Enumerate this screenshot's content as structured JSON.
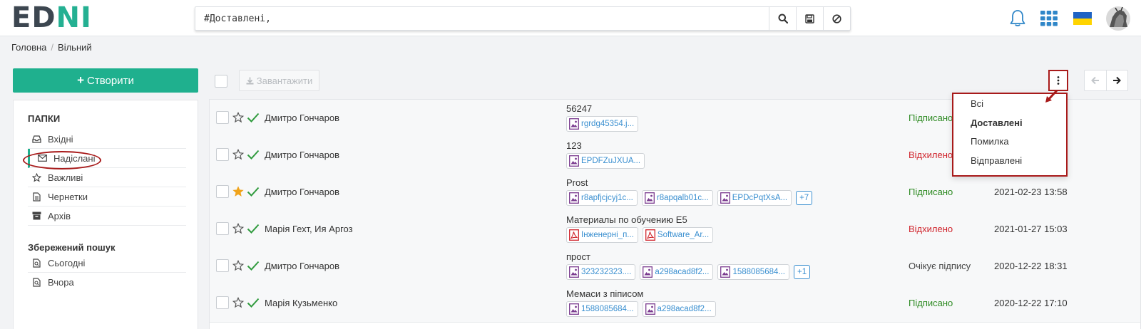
{
  "app": {
    "logo_left": "ED",
    "logo_right": "NI"
  },
  "search": {
    "value": "#Доставлені,",
    "buttons": [
      "search-icon",
      "save-icon",
      "clear-icon"
    ]
  },
  "header_icons": [
    "bell-icon",
    "apps-grid-icon",
    "ukraine-flag-icon",
    "user-avatar"
  ],
  "breadcrumb": {
    "home": "Головна",
    "current": "Вільний"
  },
  "sidebar": {
    "create_label": "Створити",
    "folders_title": "ПАПКИ",
    "folders": [
      {
        "label": "Вхідні",
        "icon": "inbox-icon"
      },
      {
        "label": "Надіслані",
        "icon": "envelope-icon",
        "active": true
      },
      {
        "label": "Важливі",
        "icon": "star-icon"
      },
      {
        "label": "Чернетки",
        "icon": "file-icon"
      },
      {
        "label": "Архів",
        "icon": "archive-icon"
      }
    ],
    "saved_title": "Збережений пошук",
    "saved": [
      {
        "label": "Сьогодні",
        "icon": "saved-search-icon"
      },
      {
        "label": "Вчора",
        "icon": "saved-search-icon"
      }
    ]
  },
  "toolbar": {
    "download_label": "Завантажити"
  },
  "dropdown": {
    "items": [
      {
        "label": "Всі",
        "selected": false
      },
      {
        "label": "Доставлені",
        "selected": true
      },
      {
        "label": "Помилка",
        "selected": false
      },
      {
        "label": "Відправлені",
        "selected": false
      }
    ]
  },
  "documents": [
    {
      "starred": false,
      "sender": "Дмитро Гончаров",
      "subject": "56247",
      "attachments": [
        {
          "name": "rgrdg45354.j...",
          "type": "image"
        }
      ],
      "more": "",
      "status": "Підписано",
      "status_color": "#2e8b23",
      "date": ""
    },
    {
      "starred": false,
      "sender": "Дмитро Гончаров",
      "subject": "123",
      "attachments": [
        {
          "name": "EPDFZuJXUA...",
          "type": "image"
        }
      ],
      "more": "",
      "status": "Відхилено",
      "status_color": "#d0242c",
      "date": ""
    },
    {
      "starred": true,
      "sender": "Дмитро Гончаров",
      "subject": "Prost",
      "attachments": [
        {
          "name": "r8apfjcjcyj1c...",
          "type": "image"
        },
        {
          "name": "r8apqalb01c...",
          "type": "image"
        },
        {
          "name": "EPDcPqtXsA...",
          "type": "image"
        }
      ],
      "more": "+7",
      "status": "Підписано",
      "status_color": "#2e8b23",
      "date": "2021-02-23 13:58"
    },
    {
      "starred": false,
      "sender": "Марія Гехт, Ия Аргоз",
      "subject": "Материалы по обучению E5",
      "attachments": [
        {
          "name": "Інженерні_п...",
          "type": "pdf"
        },
        {
          "name": "Software_Ar...",
          "type": "pdf"
        }
      ],
      "more": "",
      "status": "Відхилено",
      "status_color": "#d0242c",
      "date": "2021-01-27 15:03"
    },
    {
      "starred": false,
      "sender": "Дмитро Гончаров",
      "subject": "прост",
      "attachments": [
        {
          "name": "323232323....",
          "type": "image"
        },
        {
          "name": "a298acad8f2...",
          "type": "image"
        },
        {
          "name": "1588085684...",
          "type": "image"
        }
      ],
      "more": "+1",
      "status": "Очікує підпису",
      "status_color": "#444444",
      "date": "2020-12-22 18:31"
    },
    {
      "starred": false,
      "sender": "Марія Кузьменко",
      "subject": "Мемаси з піписом",
      "attachments": [
        {
          "name": "1588085684...",
          "type": "image"
        },
        {
          "name": "a298acad8f2...",
          "type": "image"
        }
      ],
      "more": "",
      "status": "Підписано",
      "status_color": "#2e8b23",
      "date": "2020-12-22 17:10"
    }
  ]
}
